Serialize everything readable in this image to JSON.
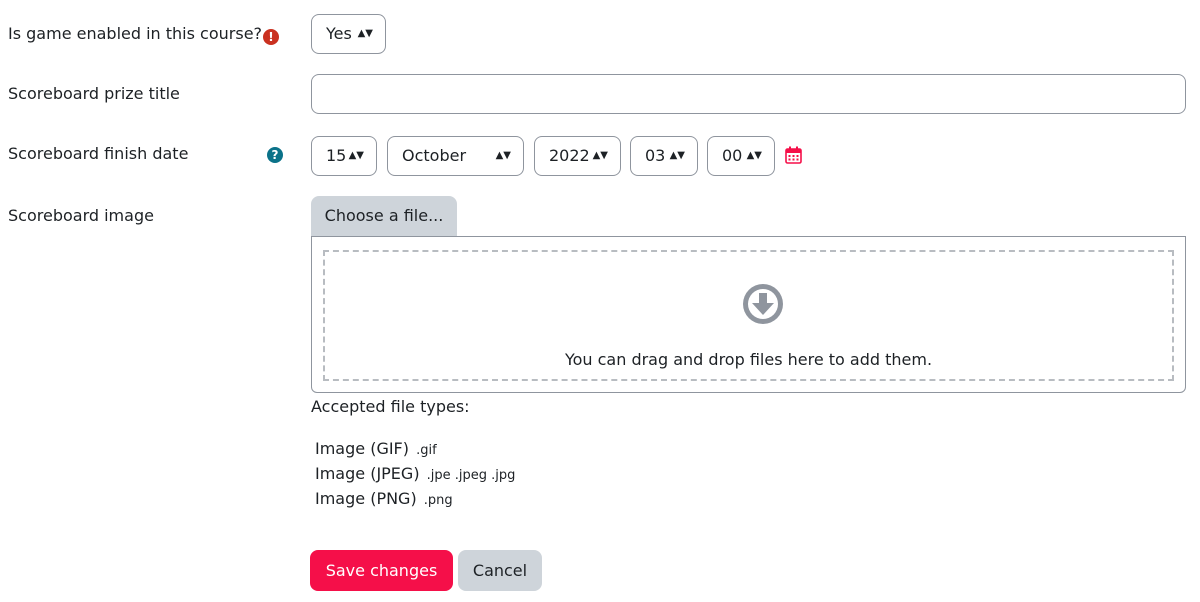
{
  "fields": {
    "game_enabled": {
      "label": "Is game enabled in this course?",
      "required_icon": "exclamation-circle-icon",
      "value": "Yes"
    },
    "prize_title": {
      "label": "Scoreboard prize title",
      "value": ""
    },
    "finish_date": {
      "label": "Scoreboard finish date",
      "help_icon": "question-circle-icon",
      "day": "15",
      "month": "October",
      "year": "2022",
      "hour": "03",
      "minute": "00",
      "calendar_icon": "calendar-icon"
    },
    "image": {
      "label": "Scoreboard image",
      "choose_label": "Choose a file...",
      "drop_icon": "download-arrow-circle-icon",
      "drop_text": "You can drag and drop files here to add them.",
      "accepted_title": "Accepted file types:",
      "types": [
        {
          "name": "Image (GIF)",
          "ext": ".gif"
        },
        {
          "name": "Image (JPEG)",
          "ext": ".jpe .jpeg .jpg"
        },
        {
          "name": "Image (PNG)",
          "ext": ".png"
        }
      ]
    }
  },
  "buttons": {
    "save": "Save changes",
    "cancel": "Cancel"
  },
  "colors": {
    "primary": "#f50f49",
    "secondary": "#ced4da",
    "required": "#ca3120",
    "help": "#0b7289",
    "calendar": "#f50f49"
  }
}
